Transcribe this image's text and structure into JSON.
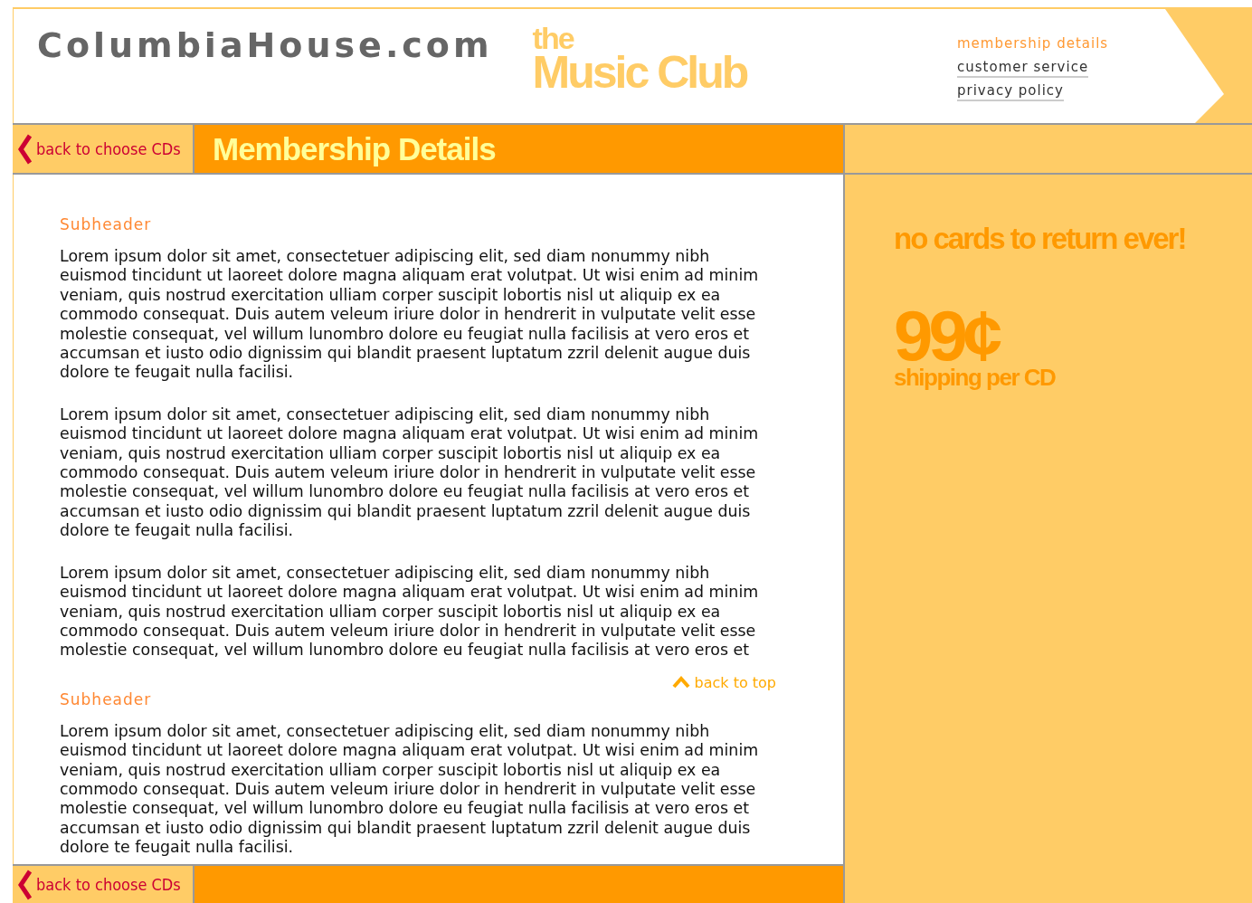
{
  "header": {
    "logo": "ColumbiaHouse.com",
    "club_small": "the",
    "club_large": "Music Club",
    "nav": [
      {
        "label": "membership details",
        "selected": true
      },
      {
        "label": "customer service",
        "selected": false
      },
      {
        "label": "privacy policy",
        "selected": false
      }
    ]
  },
  "title_bar": {
    "back_link": "back to choose CDs",
    "title": "Membership Details"
  },
  "sections": [
    {
      "subheader": "Subheader",
      "paragraphs": [
        "Lorem ipsum dolor sit amet, consectetuer adipiscing elit, sed diam nonummy nibh\neuismod tincidunt ut laoreet dolore magna aliquam erat volutpat. Ut wisi enim ad minim\nveniam, quis nostrud exercitation ulliam corper suscipit lobortis nisl ut aliquip ex ea\ncommodo consequat. Duis autem veleum iriure dolor in hendrerit in vulputate velit esse\nmolestie consequat, vel willum lunombro dolore eu feugiat nulla facilisis at vero eros et\naccumsan et iusto odio dignissim qui blandit praesent luptatum zzril delenit augue duis\ndolore te feugait nulla facilisi.",
        "Lorem ipsum dolor sit amet, consectetuer adipiscing elit, sed diam nonummy nibh\neuismod tincidunt ut laoreet dolore magna aliquam erat volutpat. Ut wisi enim ad minim\nveniam, quis nostrud exercitation ulliam corper suscipit lobortis nisl ut aliquip ex ea\ncommodo consequat. Duis autem veleum iriure dolor in hendrerit in vulputate velit esse\nmolestie consequat, vel willum lunombro dolore eu feugiat nulla facilisis at vero eros et\naccumsan et iusto odio dignissim qui blandit praesent luptatum zzril delenit augue duis\ndolore te feugait nulla facilisi.",
        "Lorem ipsum dolor sit amet, consectetuer adipiscing elit, sed diam nonummy nibh\neuismod tincidunt ut laoreet dolore magna aliquam erat volutpat. Ut wisi enim ad minim\nveniam, quis nostrud exercitation ulliam corper suscipit lobortis nisl ut aliquip ex ea\ncommodo consequat. Duis autem veleum iriure dolor in hendrerit in vulputate velit esse\nmolestie consequat, vel willum lunombro dolore eu feugiat nulla facilisis at vero eros et"
      ],
      "back_to_top": "back to top"
    },
    {
      "subheader": "Subheader",
      "paragraphs": [
        "Lorem ipsum dolor sit amet, consectetuer adipiscing elit, sed diam nonummy nibh\neuismod tincidunt ut laoreet dolore magna aliquam erat volutpat. Ut wisi enim ad minim\nveniam, quis nostrud exercitation ulliam corper suscipit lobortis nisl ut aliquip ex ea\ncommodo consequat. Duis autem veleum iriure dolor in hendrerit in vulputate velit esse\nmolestie consequat, vel willum lunombro dolore eu feugiat nulla facilisis at vero eros et\naccumsan et iusto odio dignissim qui blandit praesent luptatum zzril delenit augue duis\ndolore te feugait nulla facilisi."
      ]
    }
  ],
  "sidebar": {
    "tagline": "no cards to return ever!",
    "price": "99¢",
    "price_note": "shipping per CD"
  },
  "footer": {
    "back_link": "back to choose CDs"
  }
}
